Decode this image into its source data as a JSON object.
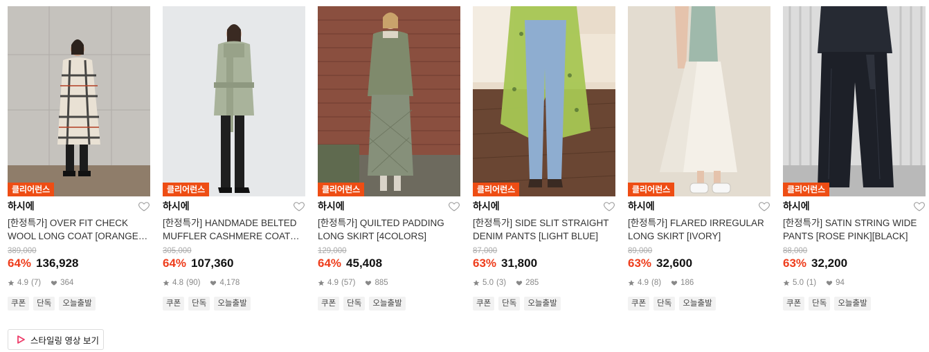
{
  "badge_label": "클리어런스",
  "products": [
    {
      "brand": "하시에",
      "name": "[한정특가] OVER FIT CHECK WOOL LONG COAT [ORANGE CHECK]",
      "original_price": "389,000",
      "discount": "64%",
      "price": "136,928",
      "rating": "4.9",
      "reviews": "(7)",
      "likes": "364",
      "tags": [
        "쿠폰",
        "단독",
        "오늘출발"
      ],
      "image_icon": "model-check-coat-image"
    },
    {
      "brand": "하시에",
      "name": "[한정특가] HANDMADE BELTED MUFFLER CASHMERE COAT [KHAKI]",
      "original_price": "305,000",
      "discount": "64%",
      "price": "107,360",
      "rating": "4.8",
      "reviews": "(90)",
      "likes": "4,178",
      "tags": [
        "쿠폰",
        "단독",
        "오늘출발"
      ],
      "image_icon": "model-khaki-coat-image"
    },
    {
      "brand": "하시에",
      "name": "[한정특가] QUILTED PADDING LONG SKIRT [4COLORS]",
      "original_price": "129,000",
      "discount": "64%",
      "price": "45,408",
      "rating": "4.9",
      "reviews": "(57)",
      "likes": "885",
      "tags": [
        "쿠폰",
        "단독",
        "오늘출발"
      ],
      "image_icon": "model-quilted-skirt-image"
    },
    {
      "brand": "하시에",
      "name": "[한정특가] SIDE SLIT STRAIGHT DENIM PANTS [LIGHT BLUE]",
      "original_price": "87,000",
      "discount": "63%",
      "price": "31,800",
      "rating": "5.0",
      "reviews": "(3)",
      "likes": "285",
      "tags": [
        "쿠폰",
        "단독",
        "오늘출발"
      ],
      "image_icon": "model-denim-pants-image"
    },
    {
      "brand": "하시에",
      "name": "[한정특가] FLARED IRREGULAR LONG SKIRT [IVORY]",
      "original_price": "89,000",
      "discount": "63%",
      "price": "32,600",
      "rating": "4.9",
      "reviews": "(8)",
      "likes": "186",
      "tags": [
        "쿠폰",
        "단독",
        "오늘출발"
      ],
      "image_icon": "model-ivory-skirt-image"
    },
    {
      "brand": "하시에",
      "name": "[한정특가] SATIN STRING WIDE PANTS [ROSE PINK][BLACK]",
      "original_price": "88,000",
      "discount": "63%",
      "price": "32,200",
      "rating": "5.0",
      "reviews": "(1)",
      "likes": "94",
      "tags": [
        "쿠폰",
        "단독",
        "오늘출발"
      ],
      "image_icon": "model-satin-pants-image"
    }
  ],
  "video_button_label": "스타일링 영상 보기",
  "colors": {
    "accent": "#ee4d14",
    "discount": "#ee3d1c"
  }
}
